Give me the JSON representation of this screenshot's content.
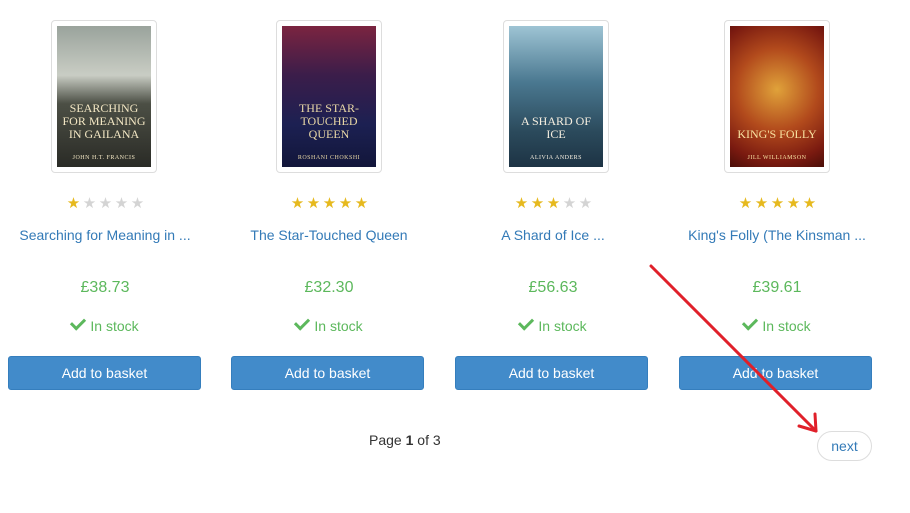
{
  "products": [
    {
      "cover_title": "SEARCHING FOR MEANING IN GAILANA",
      "cover_author": "JOHN H.T. FRANCIS",
      "rating": 1,
      "title": "Searching for Meaning in ...",
      "price": "£38.73",
      "availability": "In stock",
      "button_label": "Add to basket"
    },
    {
      "cover_title": "THE STAR-TOUCHED QUEEN",
      "cover_author": "ROSHANI CHOKSHI",
      "rating": 5,
      "title": "The Star-Touched Queen",
      "price": "£32.30",
      "availability": "In stock",
      "button_label": "Add to basket"
    },
    {
      "cover_title": "A SHARD OF ICE",
      "cover_author": "ALIVIA ANDERS",
      "rating": 3,
      "title": "A Shard of Ice ...",
      "price": "£56.63",
      "availability": "In stock",
      "button_label": "Add to basket"
    },
    {
      "cover_title": "KING'S FOLLY",
      "cover_author": "JILL WILLIAMSON",
      "rating": 5,
      "title": "King's Folly (The Kinsman ...",
      "price": "£39.61",
      "availability": "In stock",
      "button_label": "Add to basket"
    }
  ],
  "pager": {
    "prefix": "Page",
    "current": "1",
    "of_label": "of",
    "total": "3",
    "next_label": "next"
  },
  "colors": {
    "link": "#337ab7",
    "price": "#5cb85c",
    "button": "#428bca",
    "star": "#e6b91e",
    "annotation_arrow": "#e0202a"
  }
}
